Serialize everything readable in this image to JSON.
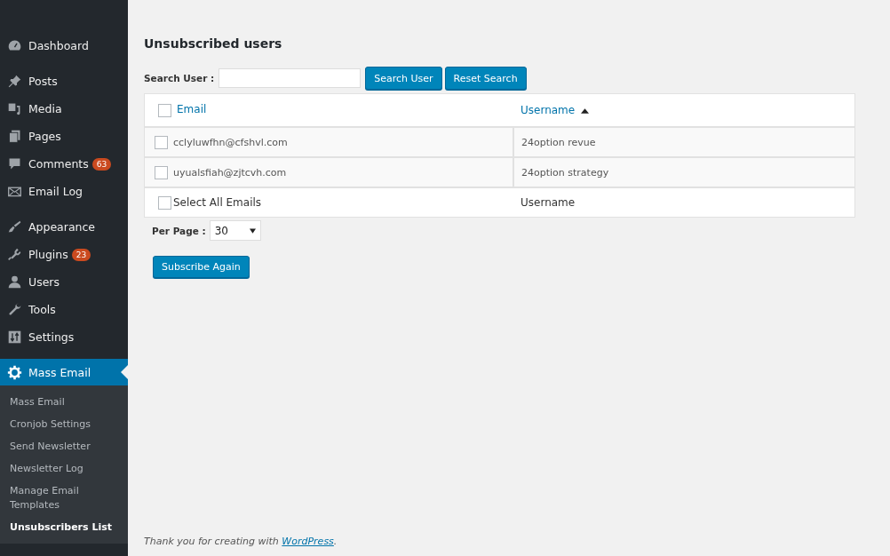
{
  "sidebar": {
    "groups": [
      [
        {
          "label": "Dashboard",
          "selected": false
        }
      ],
      [
        {
          "label": "Posts",
          "selected": false
        },
        {
          "label": "Media",
          "selected": false
        },
        {
          "label": "Pages",
          "selected": false
        },
        {
          "label": "Comments",
          "selected": false,
          "badge": "63"
        },
        {
          "label": "Email Log",
          "selected": false
        }
      ],
      [
        {
          "label": "Appearance",
          "selected": false
        },
        {
          "label": "Plugins",
          "selected": false,
          "badge": "23"
        },
        {
          "label": "Users",
          "selected": false
        },
        {
          "label": "Tools",
          "selected": false
        },
        {
          "label": "Settings",
          "selected": false
        }
      ],
      [
        {
          "label": "Mass Email",
          "selected": true
        }
      ]
    ],
    "submenu": [
      {
        "label": "Mass Email",
        "selected": false
      },
      {
        "label": "Cronjob Settings",
        "selected": false
      },
      {
        "label": "Send Newsletter",
        "selected": false
      },
      {
        "label": "Newsletter Log",
        "selected": false
      },
      {
        "label": "Manage Email Templates",
        "selected": false
      },
      {
        "label": "Unsubscribers List",
        "selected": true
      }
    ]
  },
  "page_title": "Unsubscribed users",
  "search": {
    "label": "Search User :",
    "buttons": [
      "Search User",
      "Reset Search"
    ]
  },
  "table": {
    "columns": [
      {
        "label": "Email",
        "checked": false
      },
      {
        "label": "Username",
        "sorted": true
      }
    ],
    "rows": [
      {
        "email": "cclyluwfhn@cfshvl.com",
        "username": "24option revue",
        "checked": false
      },
      {
        "email": "uyualsfiah@zjtcvh.com",
        "username": "24option strategy",
        "checked": false
      }
    ],
    "footer": {
      "select_all": "Select All Emails",
      "checked": false,
      "column_2": "Username"
    }
  },
  "per_page": {
    "label": "Per Page :",
    "value": "30"
  },
  "action_button": "Subscribe Again",
  "footer_text": {
    "prefix": "Thank you for creating with ",
    "link": "WordPress",
    "suffix": "."
  }
}
